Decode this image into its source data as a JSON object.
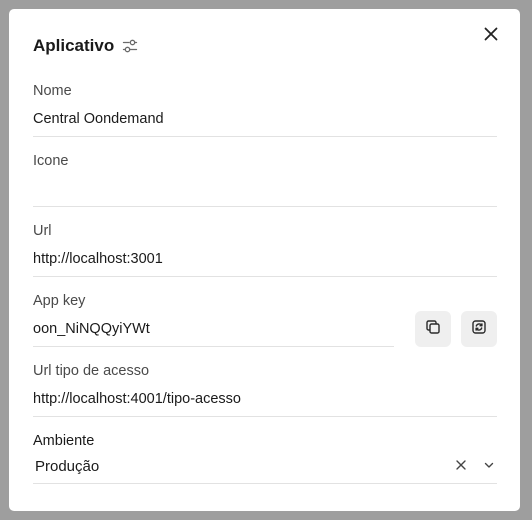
{
  "dialog": {
    "title": "Aplicativo",
    "close_icon": "close-icon",
    "settings_icon": "sliders-icon"
  },
  "fields": {
    "nome": {
      "label": "Nome",
      "value": "Central Oondemand"
    },
    "icone": {
      "label": "Icone",
      "value": ""
    },
    "url": {
      "label": "Url",
      "value": "http://localhost:3001"
    },
    "app_key": {
      "label": "App key",
      "value": "oon_NiNQQyiYWt",
      "copy_icon": "copy-icon",
      "refresh_icon": "refresh-icon"
    },
    "url_tipo_acesso": {
      "label": "Url tipo de acesso",
      "value": "http://localhost:4001/tipo-acesso"
    },
    "ambiente": {
      "label": "Ambiente",
      "value": "Produção",
      "clear_icon": "clear-icon",
      "chevron_icon": "chevron-down-icon"
    }
  },
  "colors": {
    "overlay": "#9e9e9e",
    "surface": "#ffffff",
    "text": "#1a1a1a",
    "label": "#4a4a4a",
    "divider": "#e2e2e2",
    "button_bg": "#efefef"
  }
}
